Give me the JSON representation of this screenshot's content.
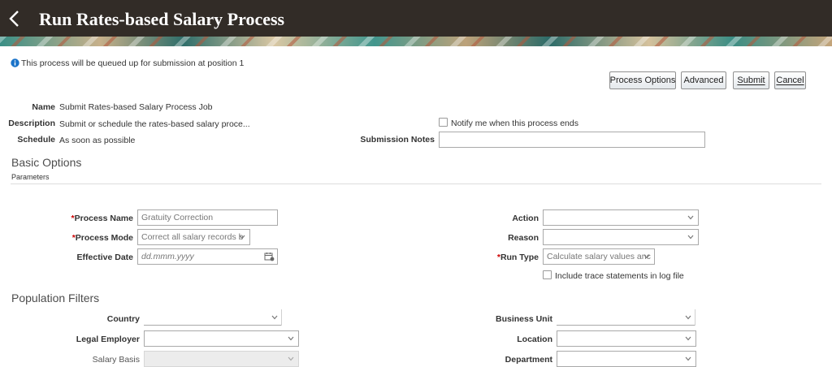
{
  "header": {
    "title": "Run Rates-based Salary Process",
    "back_icon": "chevron-left-icon"
  },
  "info": {
    "message": "This process will be queued up for submission at position 1",
    "icon": "info-icon"
  },
  "toolbar": {
    "process_options": "Process Options",
    "advanced": "Advanced",
    "submit": "Submit",
    "cancel": "Cancel"
  },
  "summary": {
    "name_label": "Name",
    "name_value": "Submit Rates-based Salary Process Job",
    "description_label": "Description",
    "description_value": "Submit or schedule the rates-based salary proce...",
    "schedule_label": "Schedule",
    "schedule_value": "As soon as possible",
    "notify_label": "Notify me when this process ends",
    "submission_notes_label": "Submission Notes",
    "submission_notes_value": ""
  },
  "basic_options": {
    "title": "Basic Options",
    "subtitle": "Parameters",
    "required_mark": "*",
    "process_name_label": "Process Name",
    "process_name_value": "Gratuity Correction",
    "process_mode_label": "Process Mode",
    "process_mode_value": "Correct all salary records b",
    "effective_date_label": "Effective Date",
    "effective_date_placeholder": "dd.mmm.yyyy",
    "action_label": "Action",
    "action_value": "",
    "reason_label": "Reason",
    "reason_value": "",
    "run_type_label": "Run Type",
    "run_type_value": "Calculate salary values anc",
    "trace_label": "Include trace statements in log file"
  },
  "population_filters": {
    "title": "Population Filters",
    "country_label": "Country",
    "country_value": "",
    "legal_employer_label": "Legal Employer",
    "legal_employer_value": "",
    "salary_basis_label": "Salary Basis",
    "salary_basis_value": "",
    "business_unit_label": "Business Unit",
    "business_unit_value": "",
    "location_label": "Location",
    "location_value": "",
    "department_label": "Department",
    "department_value": ""
  },
  "colors": {
    "header_bg": "#322c27",
    "accent_blue": "#1a73c9",
    "required_red": "#cc0000"
  }
}
